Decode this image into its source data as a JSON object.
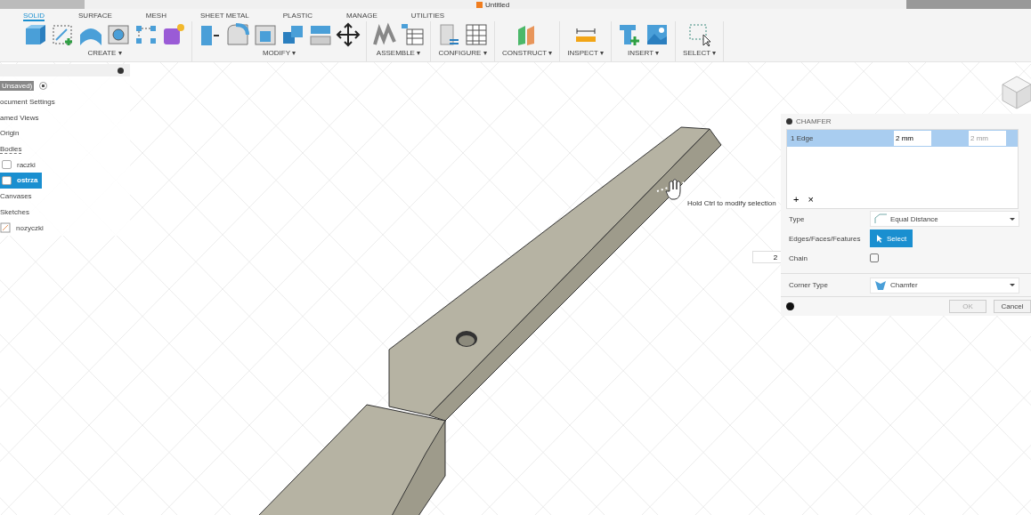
{
  "window": {
    "title": "Untitled"
  },
  "tabs": [
    {
      "label": "SOLID",
      "selected": true
    },
    {
      "label": "SURFACE",
      "selected": false
    },
    {
      "label": "MESH",
      "selected": false
    },
    {
      "label": "SHEET METAL",
      "selected": false
    },
    {
      "label": "PLASTIC",
      "selected": false
    },
    {
      "label": "MANAGE",
      "selected": false
    },
    {
      "label": "UTILITIES",
      "selected": false
    }
  ],
  "toolbar_groups": [
    {
      "label": "CREATE ▾"
    },
    {
      "label": "MODIFY ▾"
    },
    {
      "label": "ASSEMBLE ▾"
    },
    {
      "label": "CONFIGURE ▾"
    },
    {
      "label": "CONSTRUCT ▾"
    },
    {
      "label": "INSPECT ▾"
    },
    {
      "label": "INSERT ▾"
    },
    {
      "label": "SELECT ▾"
    }
  ],
  "browser": {
    "items": [
      {
        "label": "Unsaved)",
        "selected": false,
        "kind": "root",
        "children": [
          {
            "label": "ocument Settings",
            "selected": false,
            "kind": "folder"
          },
          {
            "label": "amed Views",
            "selected": false,
            "kind": "folder"
          },
          {
            "label": "Origin",
            "selected": false,
            "kind": "folder"
          },
          {
            "label": "Bodies",
            "selected": false,
            "kind": "folder",
            "children": [
              {
                "label": "raczki",
                "selected": false,
                "kind": "body"
              },
              {
                "label": "ostrza",
                "selected": true,
                "kind": "body"
              }
            ]
          },
          {
            "label": "Canvases",
            "selected": false,
            "kind": "folder"
          },
          {
            "label": "Sketches",
            "selected": false,
            "kind": "folder"
          },
          {
            "label": "nozyczki",
            "selected": false,
            "kind": "component"
          }
        ]
      }
    ]
  },
  "tooltip": "Hold Ctrl to modify selection",
  "floating_input": {
    "value": "2"
  },
  "dialog": {
    "title": "CHAMFER",
    "selection_rows": [
      {
        "label": "1 Edge",
        "selected": true,
        "distance_1": "2 mm",
        "distance_2": "2 mm"
      }
    ],
    "add_symbol": "+",
    "remove_symbol": "×",
    "fields": [
      {
        "kind": "dropdown",
        "label": "Type",
        "value": "Equal Distance"
      },
      {
        "kind": "select",
        "label": "Edges/Faces/Features",
        "value": "Select"
      },
      {
        "kind": "checkbox",
        "label": "Chain",
        "checked": false
      },
      {
        "kind": "dropdown",
        "label": "Corner Type",
        "value": "Chamfer"
      }
    ],
    "buttons": [
      {
        "label": "OK",
        "disabled": true
      },
      {
        "label": "Cancel",
        "disabled": false
      }
    ]
  }
}
